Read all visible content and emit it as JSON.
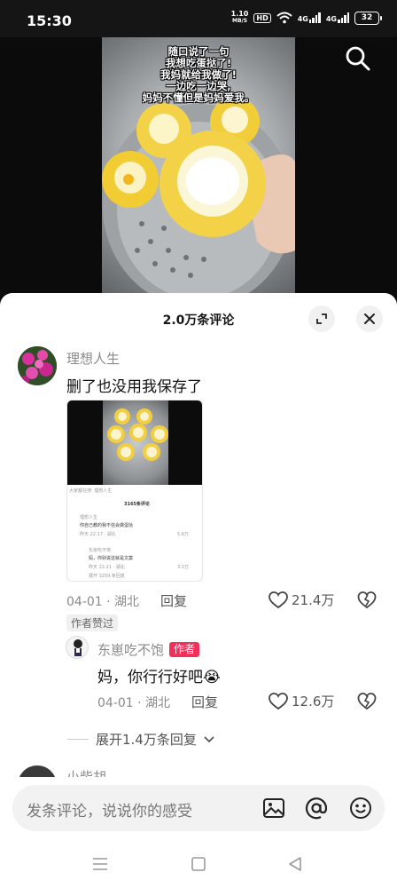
{
  "status_bar": {
    "time": "15:30",
    "net_speed_value": "1.10",
    "net_speed_unit": "MB/S",
    "hd_label": "HD",
    "signal1_label": "4G",
    "signal2_label": "4G",
    "battery": "32"
  },
  "video": {
    "caption_lines": [
      "随口说了一句",
      "我想吃蛋挞了!",
      "我妈就给我做了!",
      "一边吃一边哭,",
      "妈妈不懂但是妈妈爱我。"
    ]
  },
  "comments_panel": {
    "title": "2.0万条评论"
  },
  "comment_1": {
    "username": "理想人生",
    "text": "删了也没用我保存了",
    "date_location": "04-01 · 湖北",
    "reply_label": "回复",
    "like_count": "21.4万",
    "author_liked_badge": "作者赞过",
    "screenshot": {
      "header_line": "大家都在搜: 理想人生",
      "title": "3165条评论",
      "comment_user": "理想人生",
      "comment_text": "你自己教的我不信会做蛋挞",
      "comment_meta": "昨天 22:17 · 湖北",
      "like_a": "5.6万",
      "reply_user": "东崽吃不饱",
      "reply_text": "妈，你别说这就是文案",
      "reply_meta": "昨天 22:21 · 湖北",
      "like_b": "3.2万",
      "expand": "展开 3259 条回复"
    }
  },
  "reply_1": {
    "username": "东崽吃不饱",
    "author_tag": "作者",
    "text": "妈，你行行好吧😭",
    "date_location": "04-01 · 湖北",
    "reply_label": "回复",
    "like_count": "12.6万",
    "expand_label": "展开1.4万条回复"
  },
  "comment_2": {
    "username": "小柴胡"
  },
  "input": {
    "placeholder": "发条评论，说说你的感受"
  },
  "colors": {
    "author_tag": "#f2315a",
    "sheet_bg": "#ffffff",
    "input_bg": "#f2f2f2"
  }
}
